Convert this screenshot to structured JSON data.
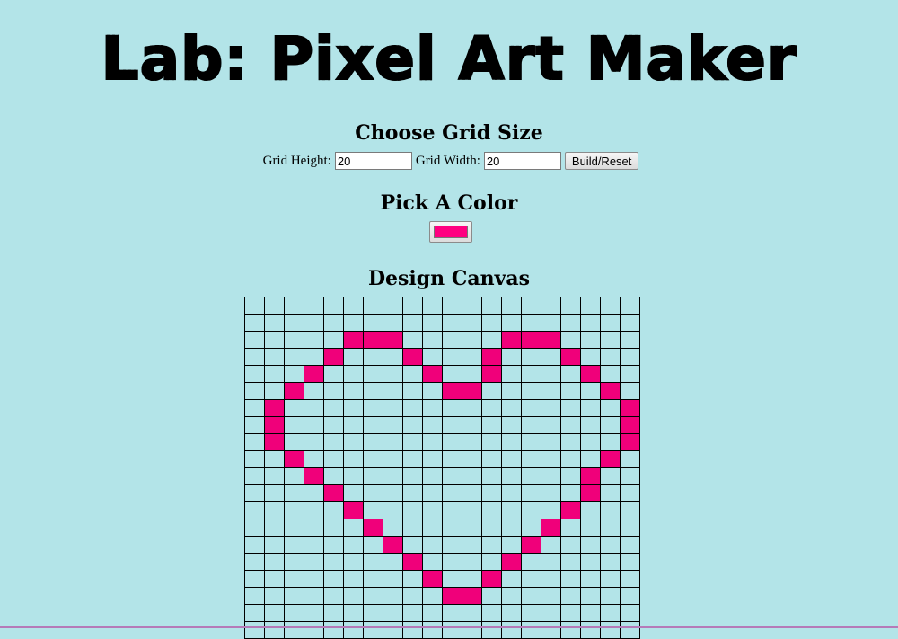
{
  "title": "Lab: Pixel Art Maker",
  "sections": {
    "grid_size_heading": "Choose Grid Size",
    "color_heading": "Pick A Color",
    "canvas_heading": "Design Canvas"
  },
  "form": {
    "height_label": "Grid Height:",
    "height_value": "20",
    "width_label": "Grid Width:",
    "width_value": "20",
    "submit_label": "Build/Reset"
  },
  "color_picker": {
    "value": "#ff0080"
  },
  "canvas": {
    "rows": 20,
    "cols": 20,
    "background": "#b3e4e8",
    "paint_color": "#f0007a",
    "painted_cells": [
      [
        2,
        5
      ],
      [
        2,
        6
      ],
      [
        2,
        7
      ],
      [
        2,
        13
      ],
      [
        2,
        14
      ],
      [
        2,
        15
      ],
      [
        3,
        4
      ],
      [
        3,
        8
      ],
      [
        3,
        12
      ],
      [
        3,
        16
      ],
      [
        4,
        3
      ],
      [
        4,
        9
      ],
      [
        4,
        12
      ],
      [
        4,
        17
      ],
      [
        5,
        2
      ],
      [
        5,
        10
      ],
      [
        5,
        11
      ],
      [
        5,
        18
      ],
      [
        6,
        1
      ],
      [
        6,
        19
      ],
      [
        7,
        1
      ],
      [
        7,
        19
      ],
      [
        8,
        1
      ],
      [
        8,
        19
      ],
      [
        9,
        2
      ],
      [
        9,
        18
      ],
      [
        10,
        3
      ],
      [
        10,
        17
      ],
      [
        11,
        4
      ],
      [
        11,
        17
      ],
      [
        12,
        5
      ],
      [
        12,
        16
      ],
      [
        13,
        6
      ],
      [
        13,
        15
      ],
      [
        14,
        7
      ],
      [
        14,
        14
      ],
      [
        15,
        8
      ],
      [
        15,
        13
      ],
      [
        16,
        9
      ],
      [
        16,
        12
      ],
      [
        17,
        10
      ],
      [
        17,
        11
      ]
    ]
  }
}
